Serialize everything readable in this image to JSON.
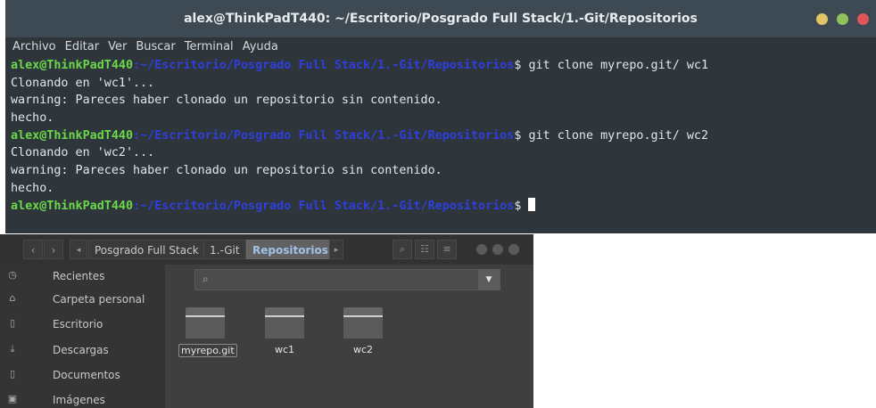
{
  "terminal": {
    "title": "alex@ThinkPadT440: ~/Escritorio/Posgrado Full Stack/1.-Git/Repositorios",
    "window_buttons": [
      {
        "name": "minimize",
        "color": "#e2c467"
      },
      {
        "name": "maximize",
        "color": "#8fc25b"
      },
      {
        "name": "close",
        "color": "#e0555a"
      }
    ],
    "menu": [
      "Archivo",
      "Editar",
      "Ver",
      "Buscar",
      "Terminal",
      "Ayuda"
    ],
    "prompt_user": "alex@ThinkPadT440",
    "prompt_path": ":~/Escritorio/Posgrado Full Stack/1.-Git/Repositorios",
    "prompt_symbol": "$ ",
    "commands": [
      "git clone myrepo.git/ wc1",
      "git clone myrepo.git/ wc2"
    ],
    "outputs": [
      "Clonando en 'wc1'...",
      "warning: Pareces haber clonado un repositorio sin contenido.",
      "hecho.",
      "Clonando en 'wc2'...",
      "warning: Pareces haber clonado un repositorio sin contenido.",
      "hecho."
    ]
  },
  "file_manager": {
    "breadcrumbs": [
      "Posgrado Full Stack",
      "1.-Git",
      "Repositorios"
    ],
    "sidebar": [
      {
        "label": "Recientes",
        "icon": "clock-icon"
      },
      {
        "label": "Carpeta personal",
        "icon": "home-icon"
      },
      {
        "label": "Escritorio",
        "icon": "desktop-folder-icon"
      },
      {
        "label": "Descargas",
        "icon": "download-icon"
      },
      {
        "label": "Documentos",
        "icon": "documents-folder-icon"
      },
      {
        "label": "Imágenes",
        "icon": "image-icon"
      }
    ],
    "folders": [
      "myrepo.git",
      "wc1",
      "wc2"
    ]
  },
  "colors": {
    "prompt_user": "#6bd84a",
    "prompt_path": "#2f3fdd",
    "breadcrumb_active": "#9fc3e8"
  }
}
